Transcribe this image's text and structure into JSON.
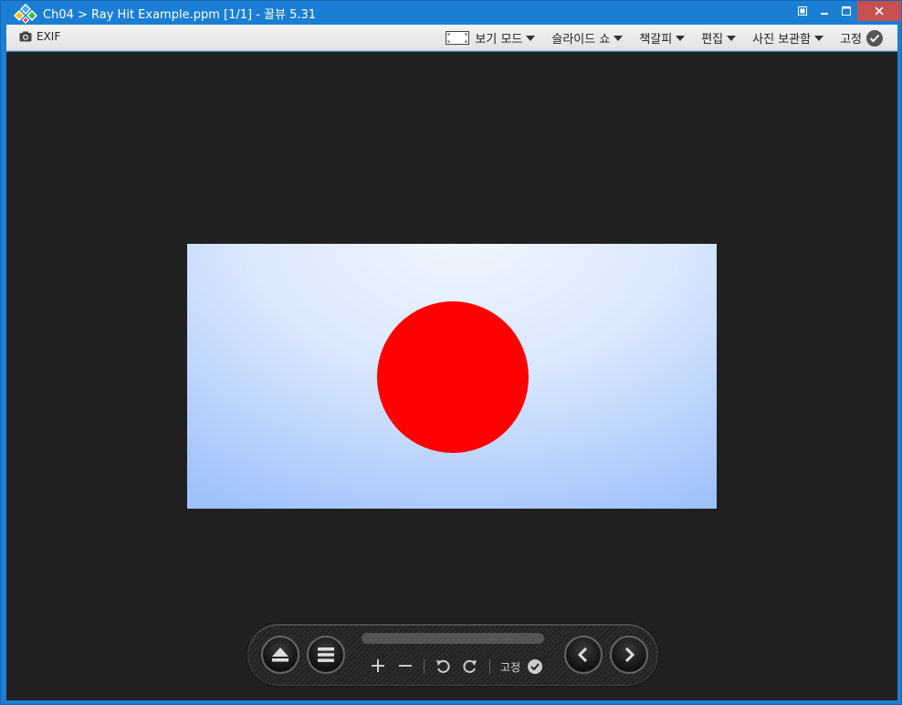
{
  "window": {
    "title": "Ch04 > Ray Hit Example.ppm [1/1] - 꿀뷰 5.31"
  },
  "menubar": {
    "exif_label": "EXIF",
    "view_mode_label": "보기 모드",
    "slideshow_label": "슬라이드 쇼",
    "bookmark_label": "책갈피",
    "edit_label": "편집",
    "photo_box_label": "사진 보관함",
    "pin_label": "고정"
  },
  "controls": {
    "pin_label": "고정"
  },
  "colors": {
    "accent": "#1a7fd4",
    "close_button": "#c75050",
    "viewer_background": "#202020",
    "sphere": "#ff0000"
  },
  "icons": [
    "app-logo-icon",
    "camera-icon",
    "fit-screen-icon",
    "caret-down-icon",
    "check-circle-icon",
    "eject-icon",
    "list-icon",
    "plus-icon",
    "minus-icon",
    "rotate-left-icon",
    "rotate-right-icon",
    "chevron-left-icon",
    "chevron-right-icon"
  ]
}
